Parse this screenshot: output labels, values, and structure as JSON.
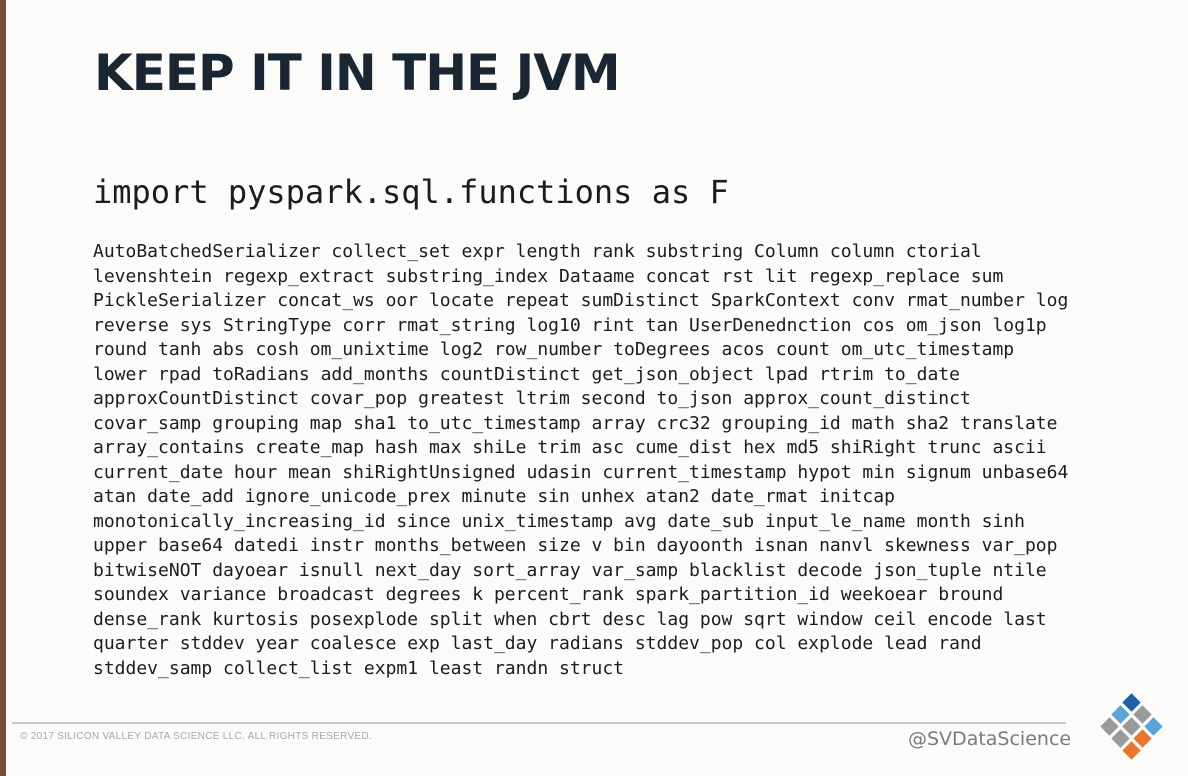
{
  "slide": {
    "title": "KEEP IT IN THE JVM",
    "import_line": "import pyspark.sql.functions as F",
    "function_lines": [
      "AutoBatchedSerializer collect_set expr length rank substring Column column ctorial",
      "levenshtein regexp_extract substring_index Dataame concat rst lit regexp_replace sum",
      "PickleSerializer concat_ws oor locate repeat sumDistinct SparkContext conv rmat_number log",
      "reverse sys StringType corr rmat_string log10 rint tan UserDenednction cos om_json log1p",
      "round tanh abs cosh om_unixtime log2 row_number toDegrees acos count om_utc_timestamp",
      "lower rpad toRadians add_months countDistinct get_json_object lpad rtrim to_date",
      "approxCountDistinct covar_pop greatest ltrim second to_json approx_count_distinct",
      "covar_samp grouping map sha1 to_utc_timestamp array crc32 grouping_id math sha2 translate",
      "array_contains create_map hash max shiLe trim asc cume_dist hex md5 shiRight trunc ascii",
      "current_date hour mean shiRightUnsigned udasin current_timestamp hypot min signum unbase64",
      "atan date_add ignore_unicode_prex minute sin unhex atan2 date_rmat initcap",
      "monotonically_increasing_id since unix_timestamp avg date_sub input_le_name month sinh",
      "upper base64 datedi instr months_between size v bin dayoonth isnan nanvl skewness var_pop",
      "bitwiseNOT dayoear isnull next_day sort_array var_samp blacklist decode json_tuple ntile",
      "soundex variance broadcast degrees k percent_rank spark_partition_id weekoear bround",
      "dense_rank kurtosis posexplode split when cbrt desc lag pow sqrt window ceil encode last",
      "quarter stddev year coalesce exp last_day radians stddev_pop col explode lead rand",
      "stddev_samp collect_list expm1 least randn struct"
    ]
  },
  "footer": {
    "copyright": "© 2017 SILICON VALLEY DATA SCIENCE LLC. ALL RIGHTS RESERVED.",
    "handle": "@SVDataScience",
    "logo_icon": "svds-diamond-logo-icon",
    "logo_colors": {
      "blue": "#1f5fa8",
      "light_blue": "#5aa3d8",
      "gray": "#9a9a9a",
      "orange": "#e8772e"
    }
  }
}
